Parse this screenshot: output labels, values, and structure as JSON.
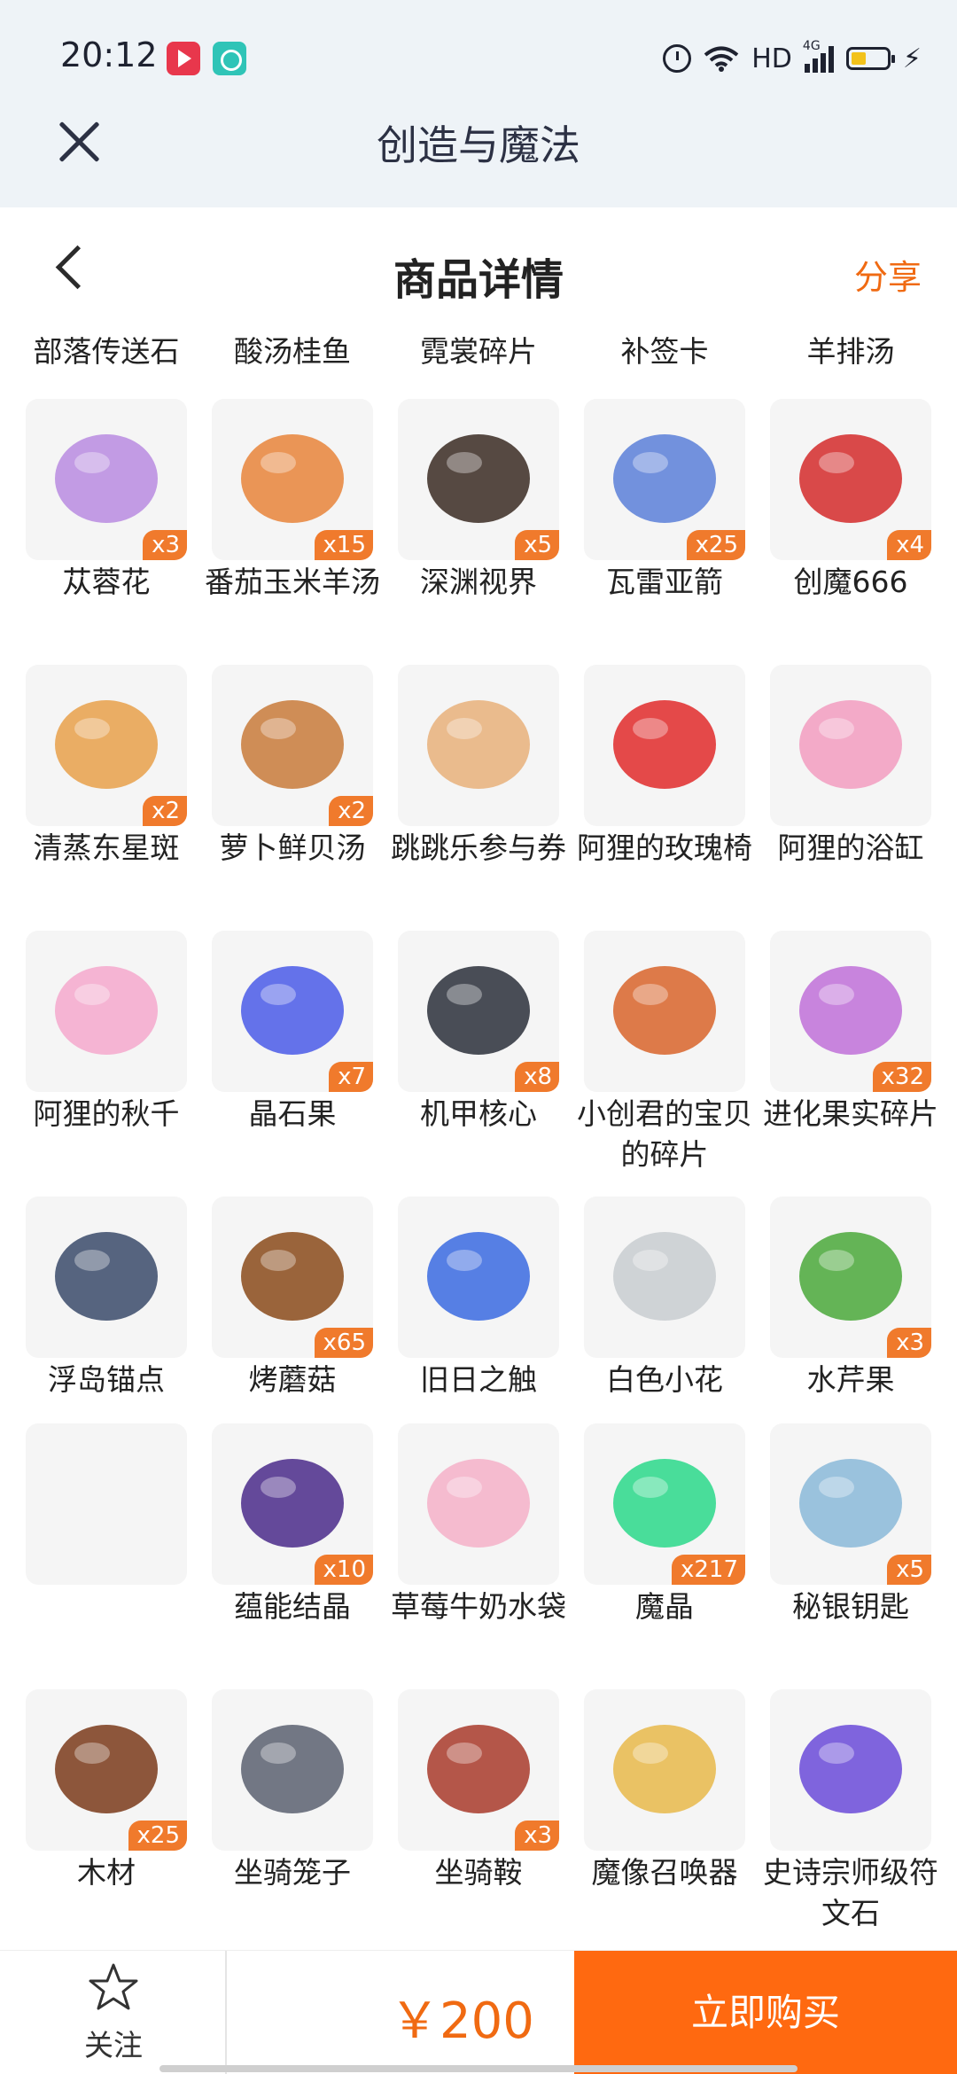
{
  "status_bar": {
    "time": "20:12",
    "hd": "HD",
    "network": "4G"
  },
  "app_title": "创造与魔法",
  "header": {
    "title": "商品详情",
    "share_label": "分享"
  },
  "partial_row": [
    "部落传送石",
    "酸汤桂鱼",
    "霓裳碎片",
    "补签卡",
    "羊排汤"
  ],
  "items": [
    {
      "name": "苁蓉花",
      "qty": "x3",
      "icon": "purple-flower-icon",
      "color": "#b98be0"
    },
    {
      "name": "番茄玉米羊汤",
      "qty": "x15",
      "icon": "soup-bowl-icon",
      "color": "#e8843a"
    },
    {
      "name": "深渊视界",
      "qty": "x5",
      "icon": "dark-vortex-sun-icon",
      "color": "#3a2a22"
    },
    {
      "name": "瓦雷亚箭",
      "qty": "x25",
      "icon": "arrows-icon",
      "color": "#5b7fd8"
    },
    {
      "name": "创魔666",
      "qty": "x4",
      "icon": "red-card-icon",
      "color": "#d42a2a"
    },
    {
      "name": "清蒸东星斑",
      "qty": "x2",
      "icon": "steamed-fish-icon",
      "color": "#e8a04a"
    },
    {
      "name": "萝卜鲜贝汤",
      "qty": "x2",
      "icon": "shell-soup-icon",
      "color": "#c87a3a"
    },
    {
      "name": "跳跳乐参与券",
      "qty": "",
      "icon": "ticket-icon",
      "color": "#e8b07a"
    },
    {
      "name": "阿狸的玫瑰椅",
      "qty": "",
      "icon": "rose-chair-icon",
      "color": "#e02a2a"
    },
    {
      "name": "阿狸的浴缸",
      "qty": "",
      "icon": "bathtub-icon",
      "color": "#f29cc0"
    },
    {
      "name": "阿狸的秋千",
      "qty": "",
      "icon": "swing-icon",
      "color": "#f4a8cc"
    },
    {
      "name": "晶石果",
      "qty": "x7",
      "icon": "blue-flame-icon",
      "color": "#4a5ae8"
    },
    {
      "name": "机甲核心",
      "qty": "x8",
      "icon": "mech-core-icon",
      "color": "#2a2f3a"
    },
    {
      "name": "小创君的宝贝的碎片",
      "qty": "",
      "icon": "puzzle-piece-icon",
      "color": "#d8642a"
    },
    {
      "name": "进化果实碎片",
      "qty": "x32",
      "icon": "fruit-slice-icon",
      "color": "#c070d8"
    },
    {
      "name": "浮岛锚点",
      "qty": "",
      "icon": "anchor-icon",
      "color": "#3a4a6a"
    },
    {
      "name": "烤蘑菇",
      "qty": "x65",
      "icon": "roasted-mushroom-icon",
      "color": "#8a4a1a"
    },
    {
      "name": "旧日之触",
      "qty": "",
      "icon": "tentacle-icon",
      "color": "#3a6ae0"
    },
    {
      "name": "白色小花",
      "qty": "",
      "icon": "white-flower-icon",
      "color": "#c8ccd0"
    },
    {
      "name": "水芹果",
      "qty": "x3",
      "icon": "green-leaves-icon",
      "color": "#4aa83a"
    },
    {
      "name": "",
      "qty": "",
      "icon": "empty-slot",
      "color": "#f5f5f5"
    },
    {
      "name": "蕴能结晶",
      "qty": "x10",
      "icon": "purple-crystal-icon",
      "color": "#4a2a8a"
    },
    {
      "name": "草莓牛奶水袋",
      "qty": "",
      "icon": "milk-carton-icon",
      "color": "#f4b0c8"
    },
    {
      "name": "魔晶",
      "qty": "x217",
      "icon": "green-orb-icon",
      "color": "#2ad88a"
    },
    {
      "name": "秘银钥匙",
      "qty": "x5",
      "icon": "silver-key-icon",
      "color": "#8ab8d8"
    },
    {
      "name": "木材",
      "qty": "x25",
      "icon": "wood-log-icon",
      "color": "#7a3a1a"
    },
    {
      "name": "坐骑笼子",
      "qty": "",
      "icon": "cage-icon",
      "color": "#5a6070"
    },
    {
      "name": "坐骑鞍",
      "qty": "x3",
      "icon": "saddle-icon",
      "color": "#a83a2a"
    },
    {
      "name": "魔像召唤器",
      "qty": "",
      "icon": "golem-summoner-icon",
      "color": "#e8b84a"
    },
    {
      "name": "史诗宗师级符文石",
      "qty": "",
      "icon": "rune-stone-icon",
      "color": "#6a4ad8"
    }
  ],
  "bottom_bar": {
    "follow_label": "关注",
    "price": "￥200",
    "buy_label": "立即购买"
  }
}
